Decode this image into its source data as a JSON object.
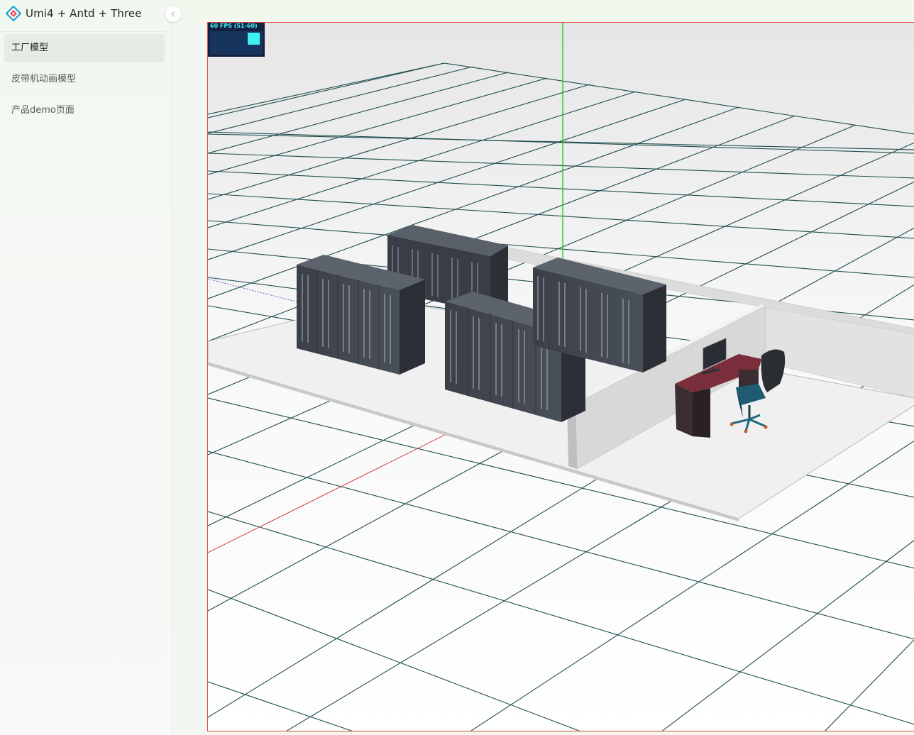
{
  "app": {
    "title": "Umi4 + Antd + Three"
  },
  "sidebar": {
    "items": [
      {
        "label": "工厂模型",
        "active": true
      },
      {
        "label": "皮带机动画模型",
        "active": false
      },
      {
        "label": "产品demo页面",
        "active": false
      }
    ]
  },
  "stats": {
    "fps_label": "60 FPS (51-60)"
  },
  "colors": {
    "accent": "#1f1f1f",
    "grid": "#1f4d4d",
    "fps_text": "#3ff5f5",
    "fps_bg": "#142040",
    "canvas_border": "#e0473f"
  },
  "icons": {
    "logo": "umi-logo-icon",
    "collapse": "chevron-left-icon"
  }
}
